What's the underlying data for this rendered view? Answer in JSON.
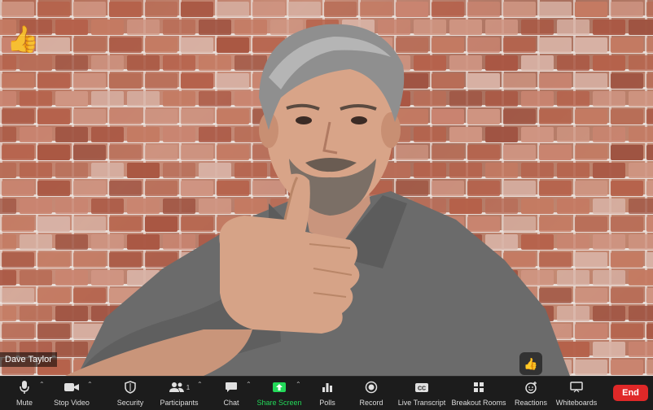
{
  "participant": {
    "name": "Dave Taylor"
  },
  "overlay": {
    "thumb_emoji": "👍",
    "reaction_emoji": "👍"
  },
  "toolbar": {
    "mute": "Mute",
    "stop_video": "Stop Video",
    "security": "Security",
    "participants": "Participants",
    "participant_count": "1",
    "chat": "Chat",
    "share_screen": "Share Screen",
    "polls": "Polls",
    "record": "Record",
    "live_transcript": "Live Transcript",
    "cc": "CC",
    "breakout_rooms": "Breakout Rooms",
    "reactions": "Reactions",
    "whiteboards": "Whiteboards",
    "end": "End"
  },
  "colors": {
    "end": "#e02828",
    "share": "#23d959",
    "toolbar_bg": "#1c1c1c"
  }
}
